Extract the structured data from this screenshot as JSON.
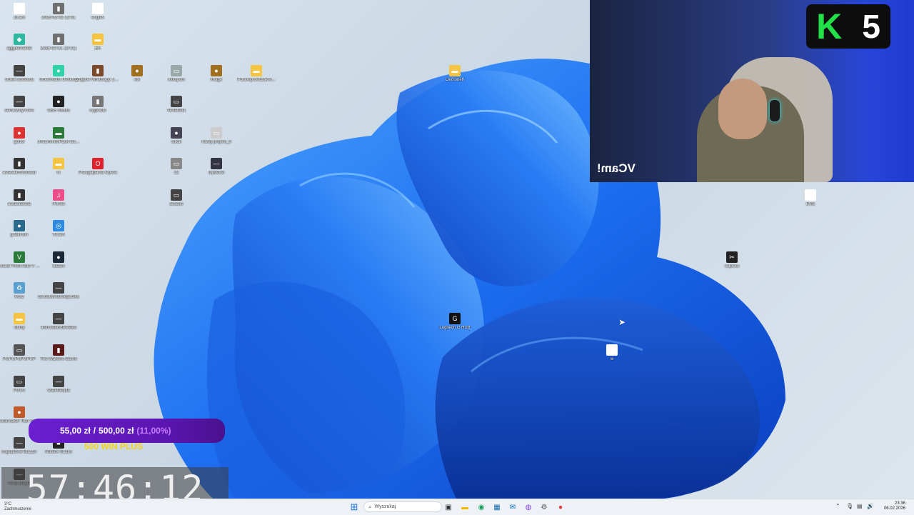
{
  "desktop": {
    "icons": [
      {
        "label": "1tl.arx",
        "color": "#ffffff",
        "glyph": "▭"
      },
      {
        "label": "2026-02-02 12-01",
        "color": "#6f6f6f",
        "glyph": "▮"
      },
      {
        "label": "engles",
        "color": "#ffffff",
        "glyph": "▭"
      },
      {
        "label": "aggpebrakde",
        "color": "#2fb8a0",
        "glyph": "◆"
      },
      {
        "label": "2026-02-01 12-011",
        "color": "#6f6f6f",
        "glyph": "▮"
      },
      {
        "label": "ER",
        "color": "#f5c542",
        "glyph": "▬"
      },
      {
        "label": "stoiek-asdasda",
        "color": "#444",
        "glyph": "—"
      },
      {
        "label": "Streamlabs Desktop",
        "color": "#2fd3a8",
        "glyph": "●"
      },
      {
        "label": "Zdjęcie Whatsapp 2026-02-01 o 11...",
        "color": "#7a4a2a",
        "glyph": "▮"
      },
      {
        "label": "etk",
        "color": "#a07020",
        "glyph": "●"
      },
      {
        "label": "mikspots",
        "color": "#9aa",
        "glyph": "▭"
      },
      {
        "label": "image",
        "color": "#a07020",
        "glyph": "●"
      },
      {
        "label": "Pizaneprzedzakre...",
        "color": "#f5c542",
        "glyph": "▬"
      },
      {
        "label": "Demoneh",
        "color": "#f5c542",
        "glyph": "▬"
      },
      {
        "label": "semikwnyi-mes",
        "color": "#444",
        "glyph": "—"
      },
      {
        "label": "OBS Studio",
        "color": "#222",
        "glyph": "●"
      },
      {
        "label": "myphoto",
        "color": "#777",
        "glyph": "▮"
      },
      {
        "label": "fantaferla",
        "color": "#444",
        "glyph": "▭"
      },
      {
        "label": "gotfor",
        "color": "#d33",
        "glyph": "●"
      },
      {
        "label": "UncommonPack Gaming Game...",
        "color": "#2a7a3a",
        "glyph": "▬"
      },
      {
        "label": "sukar",
        "color": "#445",
        "glyph": "●"
      },
      {
        "label": "Nowy projekt_9",
        "color": "#ccc",
        "glyph": "▭"
      },
      {
        "label": "aslasdasdasdasd",
        "color": "#333",
        "glyph": "▮"
      },
      {
        "label": "nt",
        "color": "#f5c542",
        "glyph": "▬"
      },
      {
        "label": "Przeglądarka Opera",
        "color": "#e0202a",
        "glyph": "O"
      },
      {
        "label": "22",
        "color": "#888",
        "glyph": "▭"
      },
      {
        "label": "topsetist",
        "color": "#334",
        "glyph": "—"
      },
      {
        "label": "Bnla",
        "color": "#fff",
        "glyph": "▭"
      },
      {
        "label": "asdasdasda",
        "color": "#333",
        "glyph": "▮"
      },
      {
        "label": "iTunes",
        "color": "#ee4d8a",
        "glyph": "♫"
      },
      {
        "label": "asasas",
        "color": "#444",
        "glyph": "▭"
      },
      {
        "label": "graikmon",
        "color": "#2a6a8a",
        "glyph": "●"
      },
      {
        "label": "VCam",
        "color": "#2c8ae0",
        "glyph": "◎"
      },
      {
        "label": "CapCut",
        "color": "#222",
        "glyph": "✂"
      },
      {
        "label": "Grand Theft Auto V Legacy",
        "color": "#2a7a3a",
        "glyph": "V"
      },
      {
        "label": "Steam",
        "color": "#1b2838",
        "glyph": "●"
      },
      {
        "label": "Kosz",
        "color": "#5aa0d0",
        "glyph": "♻"
      },
      {
        "label": "barbarafinansejadska",
        "color": "#444",
        "glyph": "—"
      },
      {
        "label": "Logitech G HUB",
        "color": "#111",
        "glyph": "G"
      },
      {
        "label": "Stacy",
        "color": "#f5c542",
        "glyph": "▬"
      },
      {
        "label": "asldasdasdasdasd",
        "color": "#444",
        "glyph": "—"
      },
      {
        "label": "PUPUPUPUPUP",
        "color": "#555",
        "glyph": "▭"
      },
      {
        "label": "The Walkers Game",
        "color": "#5a1a1a",
        "glyph": "▮"
      },
      {
        "label": "w",
        "color": "#fff",
        "glyph": "▭"
      },
      {
        "label": "PINXI",
        "color": "#444",
        "glyph": "▭"
      },
      {
        "label": "wazkfalopla",
        "color": "#444",
        "glyph": "—"
      },
      {
        "label": "Bookmaker Tour Online Hustle",
        "color": "#c05a2a",
        "glyph": "●"
      },
      {
        "label": "Roblox Studio",
        "color": "#222",
        "glyph": "■"
      },
      {
        "label": "hogoplowe Buzzer",
        "color": "#444",
        "glyph": "—"
      },
      {
        "label": "nowy plugin",
        "color": "#444",
        "glyph": "—"
      }
    ]
  },
  "webcam": {
    "overlay_text": "VCam!",
    "logo_letter": "K",
    "logo_number": "5",
    "logo_color": "#21e048"
  },
  "donation": {
    "current": "55,00 zł",
    "separator": "/",
    "goal": "500,00 zł",
    "percent": "(11,00%)",
    "label": "500 WIN PLUS"
  },
  "timer": {
    "value": "57:46:12"
  },
  "taskbar": {
    "search_placeholder": "Wyszukaj",
    "weather_temp": "3°C",
    "weather_desc": "Zachmurzenie",
    "time": "23:36",
    "date": "06.02.2026"
  }
}
